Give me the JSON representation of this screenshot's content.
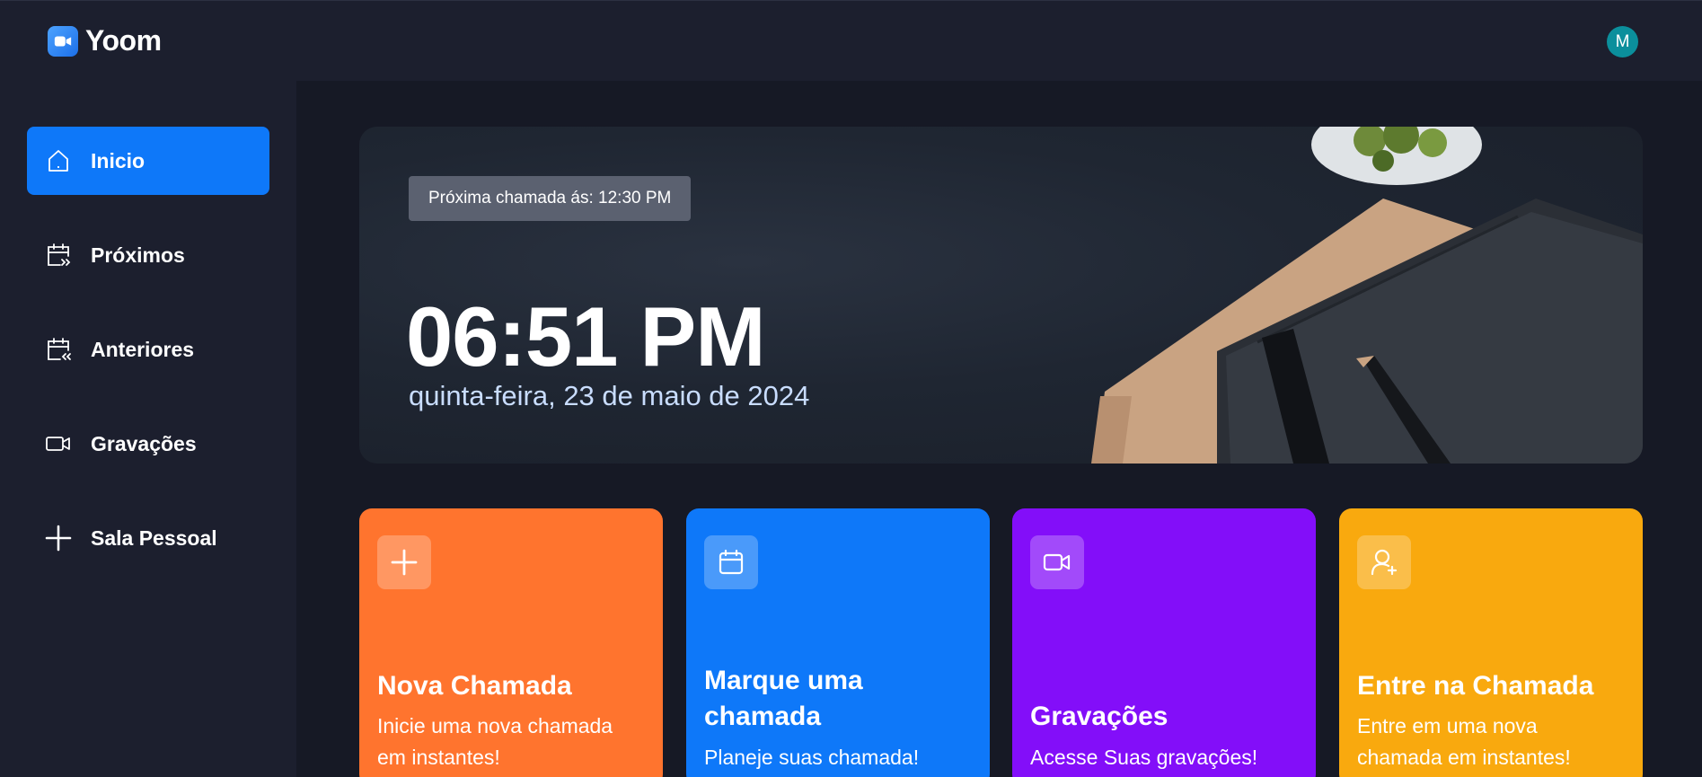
{
  "app": {
    "name": "Yoom"
  },
  "user": {
    "avatar_letter": "M"
  },
  "sidebar": {
    "items": [
      {
        "label": "Inicio",
        "icon": "home-icon",
        "active": true
      },
      {
        "label": "Próximos",
        "icon": "calendar-next-icon",
        "active": false
      },
      {
        "label": "Anteriores",
        "icon": "calendar-previous-icon",
        "active": false
      },
      {
        "label": "Gravações",
        "icon": "video-icon",
        "active": false
      },
      {
        "label": "Sala Pessoal",
        "icon": "plus-icon",
        "active": false
      }
    ]
  },
  "hero": {
    "next_call": "Próxima chamada ás: 12:30 PM",
    "time": "06:51 PM",
    "date": "quinta-feira, 23 de maio de 2024"
  },
  "cards": [
    {
      "title": "Nova Chamada",
      "description": "Inicie uma nova chamada em instantes!",
      "icon": "plus-icon",
      "color": "#ff742e"
    },
    {
      "title": "Marque uma chamada",
      "description": "Planeje suas chamada!",
      "icon": "calendar-icon",
      "color": "#0e78f9"
    },
    {
      "title": "Gravações",
      "description": "Acesse Suas gravações!",
      "icon": "video-icon",
      "color": "#830ef9"
    },
    {
      "title": "Entre na Chamada",
      "description": "Entre em uma nova chamada em instantes!",
      "icon": "user-add-icon",
      "color": "#f9a90e"
    }
  ],
  "colors": {
    "sidebar_bg": "#1c1f2e",
    "main_bg": "#161925",
    "accent": "#0e78f9"
  }
}
